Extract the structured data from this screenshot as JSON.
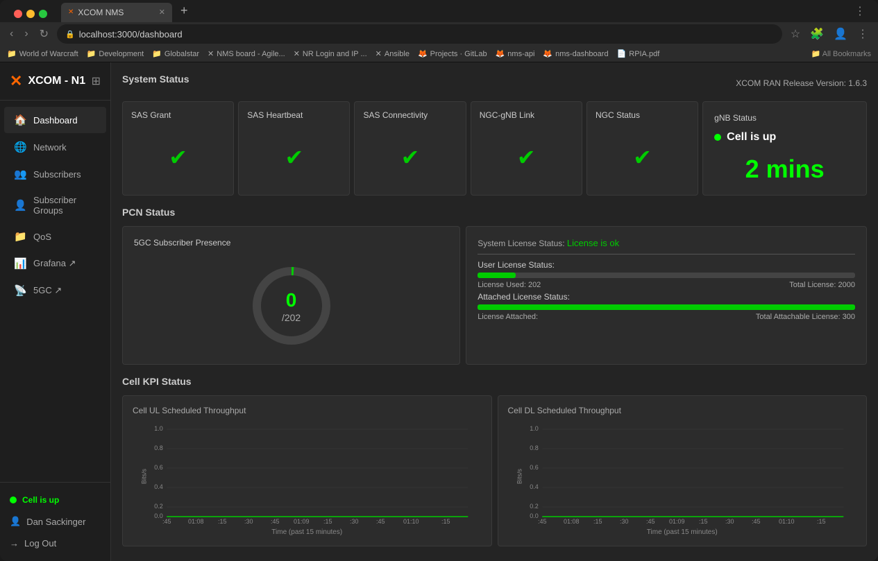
{
  "browser": {
    "tab_title": "XCOM NMS",
    "url": "localhost:3000/dashboard",
    "new_tab_label": "+",
    "bookmarks": [
      "World of Warcraft",
      "Development",
      "Globalstar",
      "NMS board - Agile...",
      "NR Login and IP ...",
      "Ansible",
      "Projects · GitLab",
      "nms-api",
      "nms-dashboard",
      "RPIA.pdf"
    ],
    "all_bookmarks": "All Bookmarks"
  },
  "app": {
    "logo": "XCOM - N1",
    "release_version": "XCOM RAN Release Version: 1.6.3"
  },
  "sidebar": {
    "items": [
      {
        "id": "dashboard",
        "label": "Dashboard",
        "active": true
      },
      {
        "id": "network",
        "label": "Network",
        "active": false
      },
      {
        "id": "subscribers",
        "label": "Subscribers",
        "active": false
      },
      {
        "id": "subscriber-groups",
        "label": "Subscriber Groups",
        "active": false
      },
      {
        "id": "qos",
        "label": "QoS",
        "active": false
      },
      {
        "id": "grafana",
        "label": "Grafana ↗",
        "active": false
      },
      {
        "id": "5gc",
        "label": "5GC ↗",
        "active": false
      }
    ],
    "cell_status": "Cell is up",
    "user": "Dan Sackinger",
    "logout": "Log Out"
  },
  "system_status": {
    "title": "System Status",
    "cards": [
      {
        "id": "sas-grant",
        "label": "SAS Grant",
        "status": "ok"
      },
      {
        "id": "sas-heartbeat",
        "label": "SAS Heartbeat",
        "status": "ok"
      },
      {
        "id": "sas-connectivity",
        "label": "SAS Connectivity",
        "status": "ok"
      },
      {
        "id": "ngc-gnb-link",
        "label": "NGC-gNB Link",
        "status": "ok"
      },
      {
        "id": "ngc-status",
        "label": "NGC Status",
        "status": "ok"
      }
    ],
    "gnb": {
      "title": "gNB Status",
      "cell_up": "Cell is up",
      "uptime": "2 mins"
    }
  },
  "pcn_status": {
    "title": "PCN Status",
    "chart_title": "5GC Subscriber Presence",
    "donut_value": "0",
    "donut_sub": "/202",
    "license": {
      "system_label": "System License Status:",
      "system_value": "License is ok",
      "user_label": "User License Status:",
      "used_label": "License Used: 202",
      "total_label": "Total License: 2000",
      "used_percent": 10,
      "attached_label": "Attached License Status:",
      "attached_used_label": "License Attached:",
      "attached_total_label": "Total Attachable License: 300",
      "attached_percent": 100
    }
  },
  "cell_kpi": {
    "title": "Cell KPI Status",
    "ul_title": "Cell UL Scheduled Throughput",
    "dl_title": "Cell DL Scheduled Throughput",
    "y_label": "Bits/s",
    "x_label": "Time (past 15 minutes)",
    "y_max": "1.0",
    "y_08": "0.8",
    "y_06": "0.6",
    "y_04": "0.4",
    "y_02": "0.2",
    "y_00": "0.0",
    "x_ticks": [
      ":45",
      "01:08",
      ":15",
      ":30",
      ":45",
      "01:09",
      ":15",
      ":30",
      ":45",
      "01:10",
      ":15"
    ]
  }
}
